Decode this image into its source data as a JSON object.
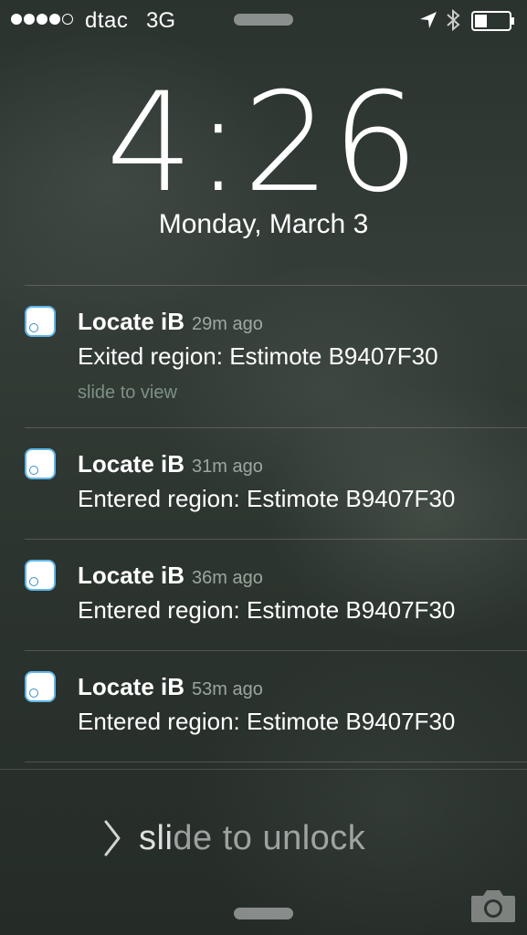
{
  "status_bar": {
    "signal_filled": 4,
    "signal_total": 5,
    "carrier": "dtac",
    "network": "3G",
    "battery_level": 0.35,
    "icons": [
      "location-arrow-icon",
      "bluetooth-icon",
      "battery-icon"
    ]
  },
  "lock_screen": {
    "time": "4:26",
    "date": "Monday, March 3"
  },
  "notifications": [
    {
      "app": "Locate iB",
      "time_ago": "29m ago",
      "message": "Exited region: Estimote B9407F30",
      "hint": "slide to view"
    },
    {
      "app": "Locate iB",
      "time_ago": "31m ago",
      "message": "Entered region: Estimote B9407F30"
    },
    {
      "app": "Locate iB",
      "time_ago": "36m ago",
      "message": "Entered region: Estimote B9407F30"
    },
    {
      "app": "Locate iB",
      "time_ago": "53m ago",
      "message": "Entered region: Estimote B9407F30"
    }
  ],
  "unlock": {
    "text_highlight": "sli",
    "text_rest": "de to unlock"
  },
  "colors": {
    "app_icon_border": "#5fb6e8"
  }
}
